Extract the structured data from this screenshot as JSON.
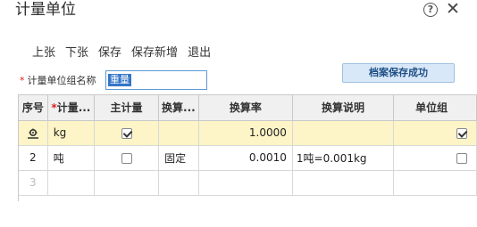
{
  "window": {
    "title": "计量单位"
  },
  "toolbar": {
    "prev": "上张",
    "next": "下张",
    "save": "保存",
    "save_new": "保存新增",
    "exit": "退出"
  },
  "form": {
    "required_mark": "*",
    "group_name_label": "计量单位组名称",
    "group_name_value": "重量"
  },
  "toast": {
    "message": "档案保存成功"
  },
  "table": {
    "headers": {
      "seq": "序号",
      "unit_required": "*",
      "unit": "计量...",
      "main": "主计量",
      "conv": "换算...",
      "rate": "换算率",
      "desc": "换算说明",
      "unit_group": "单位组"
    },
    "rows": [
      {
        "seq": "",
        "unit": "kg",
        "main_checked": true,
        "conv": "",
        "rate": "1.0000",
        "desc": "",
        "group_checked": true
      },
      {
        "seq": "2",
        "unit": "吨",
        "main_checked": false,
        "conv": "固定",
        "rate": "0.0010",
        "desc": "1吨=0.001kg",
        "group_checked": false
      },
      {
        "seq": "3",
        "unit": "",
        "main_checked": false,
        "conv": "",
        "rate": "",
        "desc": "",
        "group_checked": false
      }
    ]
  }
}
